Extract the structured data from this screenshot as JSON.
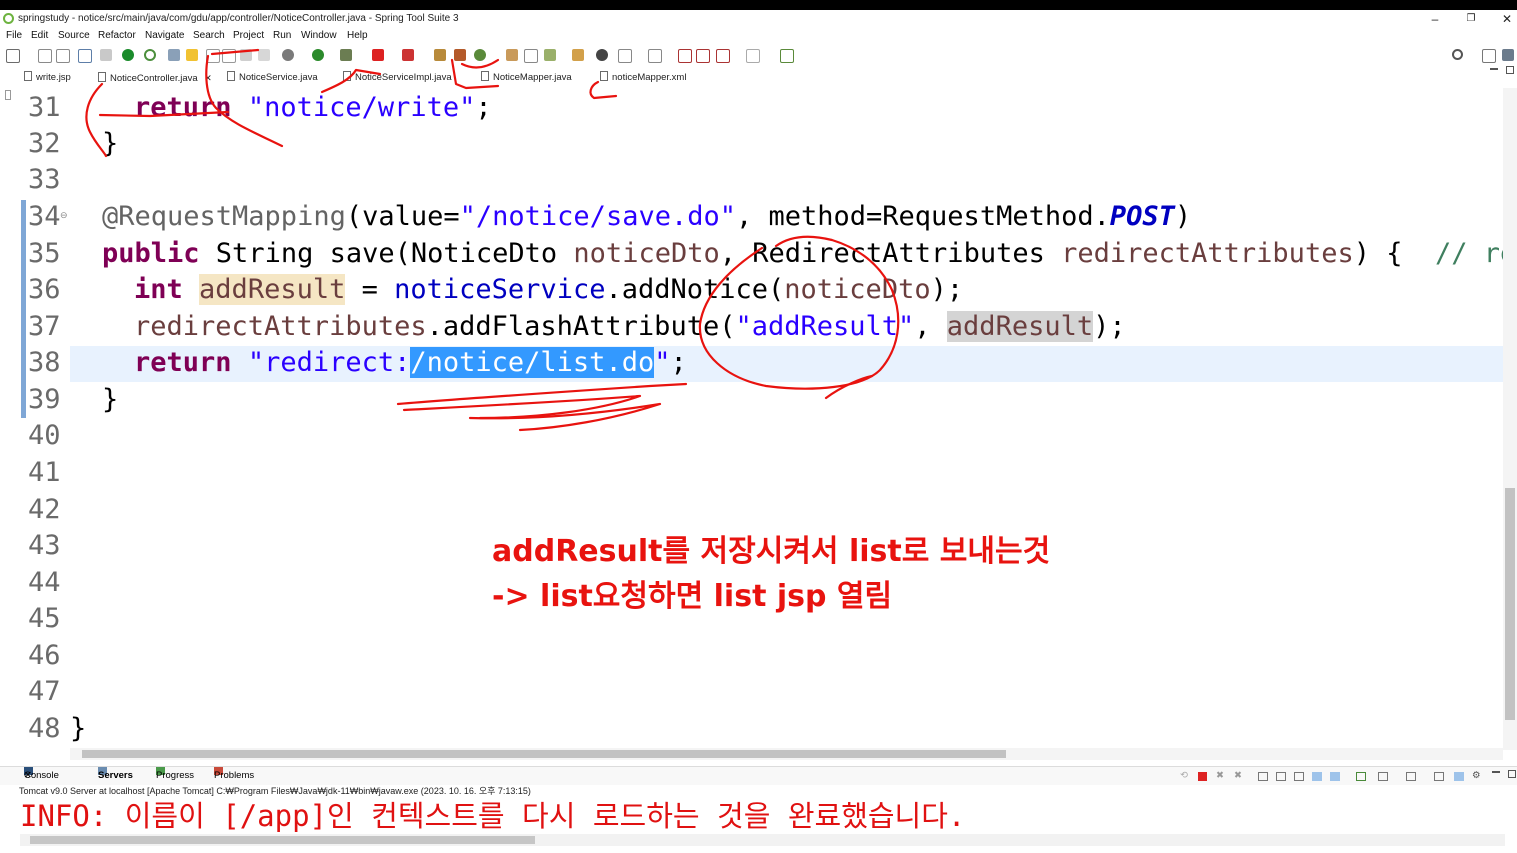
{
  "window": {
    "title": "springstudy - notice/src/main/java/com/gdu/app/controller/NoticeController.java - Spring Tool Suite 3",
    "minimize": "–",
    "restore": "❐",
    "close": "✕"
  },
  "menu": [
    "File",
    "Edit",
    "Source",
    "Refactor",
    "Navigate",
    "Search",
    "Project",
    "Run",
    "Window",
    "Help"
  ],
  "tabs": [
    {
      "label": "write.jsp"
    },
    {
      "label": "NoticeController.java",
      "close": "✕"
    },
    {
      "label": "NoticeService.java"
    },
    {
      "label": "NoticeServiceImpl.java"
    },
    {
      "label": "NoticeMapper.java"
    },
    {
      "label": "noticeMapper.xml"
    }
  ],
  "editor": {
    "line_numbers": [
      "31",
      "32",
      "33",
      "34",
      "35",
      "36",
      "37",
      "38",
      "39",
      "40",
      "41",
      "42",
      "43",
      "44",
      "45",
      "46",
      "47",
      "48"
    ],
    "code": {
      "l31": {
        "kw": "return",
        "sp": " ",
        "str": "\"notice/write\"",
        "end": ";"
      },
      "l32": {
        "text": "}"
      },
      "l34": {
        "ann": "@RequestMapping",
        "p1": "(value=",
        "str": "\"/notice/save.do\"",
        "p2": ", method=RequestMethod.",
        "const": "POST",
        "p3": ")"
      },
      "l35": {
        "kw": "public",
        "p1": " String save(NoticeDto ",
        "v1": "noticeDto",
        "p2": ", RedirectAttributes ",
        "v2": "redirectAttributes",
        "p3": ") {  ",
        "cm": "// red"
      },
      "l36": {
        "kw": "int",
        "sp": " ",
        "var": "addResult",
        "p1": " = ",
        "fld": "noticeService",
        "p2": ".addNotice(",
        "v1": "noticeDto",
        "p3": ");"
      },
      "l37": {
        "v1": "redirectAttributes",
        "p1": ".addFlashAttribute(",
        "str": "\"addResult\"",
        "p2": ", ",
        "var": "addResult",
        "p3": ");"
      },
      "l38": {
        "kw": "return",
        "sp": " ",
        "str_a": "\"redirect:",
        "sel": "/notice/list.do",
        "str_b": "\"",
        "end": ";"
      },
      "l39": {
        "text": "}"
      },
      "l48": {
        "text": "}"
      }
    }
  },
  "annotation_text": {
    "line1": "addResult를 저장시켜서 list로 보내는것",
    "line2": "-> list요청하면 list jsp 열림"
  },
  "console": {
    "tabs": [
      "Console",
      "Servers",
      "Progress",
      "Problems"
    ],
    "close": "✕",
    "description": "Tomcat v9.0 Server at localhost [Apache Tomcat] C:₩Program Files₩Java₩jdk-11₩bin₩javaw.exe  (2023. 10. 16. 오후 7:13:15)",
    "output": "INFO: 이름이 [/app]인 컨텍스트를 다시 로드하는 것을 완료했습니다."
  },
  "colors": {
    "keyword": "#7f0055",
    "string": "#2a00ff",
    "annotation_pen": "#e8130f",
    "selection": "#3399ff"
  }
}
